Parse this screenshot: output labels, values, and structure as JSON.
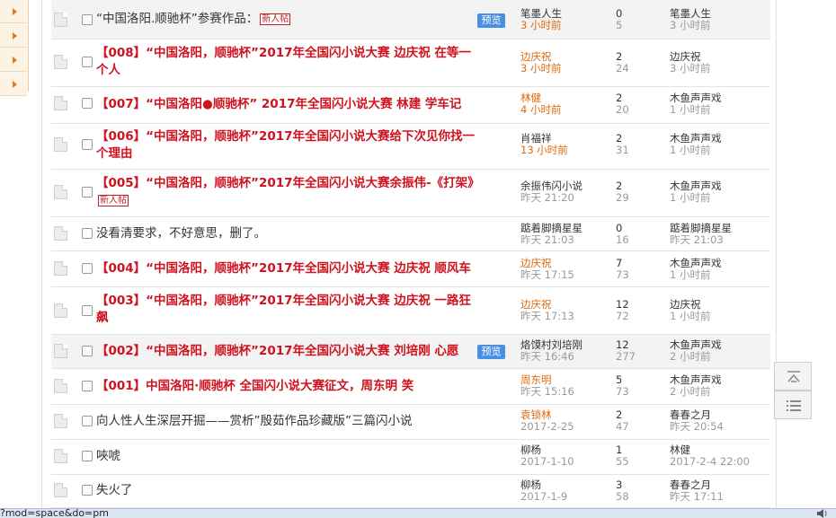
{
  "threads": [
    {
      "title": "“中国洛阳.顺驰杯”参赛作品：",
      "style": "plain",
      "newtag": "新人帖",
      "preview": "预览",
      "author": "笔墨人生",
      "author_time": "3 小时前",
      "author_orange": false,
      "time_orange": true,
      "replies": "0",
      "views": "5",
      "last": "笔墨人生",
      "last_time": "3 小时前",
      "hl": true
    },
    {
      "title": "【008】“中国洛阳，顺驰杯”2017年全国闪小说大赛 边庆祝 在等一个人",
      "style": "red",
      "author": "边庆祝",
      "author_time": "3 小时前",
      "author_orange": true,
      "time_orange": true,
      "replies": "2",
      "views": "24",
      "last": "边庆祝",
      "last_time": "3 小时前"
    },
    {
      "title": "【007】“中国洛阳●顺驰杯” 2017年全国闪小说大赛 林建 学车记",
      "style": "red",
      "author": "林健",
      "author_time": "4 小时前",
      "author_orange": true,
      "time_orange": true,
      "replies": "2",
      "views": "20",
      "last": "木鱼声声戏",
      "last_time": "1 小时前"
    },
    {
      "title": "【006】“中国洛阳，顺驰杯”2017年全国闪小说大赛给下次见你找一个理由",
      "style": "red",
      "author": "肖福祥",
      "author_time": "13 小时前",
      "author_orange": false,
      "time_orange": true,
      "replies": "2",
      "views": "31",
      "last": "木鱼声声戏",
      "last_time": "1 小时前"
    },
    {
      "title": "【005】“中国洛阳，顺驰杯”2017年全国闪小说大赛余振伟-《打架》",
      "style": "red",
      "newtag": "新人帖",
      "author": "余振伟闪小说",
      "author_time": "昨天 21:20",
      "author_orange": false,
      "time_orange": false,
      "replies": "2",
      "views": "29",
      "last": "木鱼声声戏",
      "last_time": "1 小时前"
    },
    {
      "title": "没看清要求，不好意思，删了。",
      "style": "plain",
      "author": "踮着脚摘星星",
      "author_time": "昨天 21:03",
      "author_orange": false,
      "time_orange": false,
      "replies": "0",
      "views": "16",
      "last": "踮着脚摘星星",
      "last_time": "昨天 21:03"
    },
    {
      "title": "【004】“中国洛阳，顺驰杯”2017年全国闪小说大赛 边庆祝 顺风车",
      "style": "red",
      "author": "边庆祝",
      "author_time": "昨天 17:15",
      "author_orange": true,
      "time_orange": false,
      "replies": "7",
      "views": "73",
      "last": "木鱼声声戏",
      "last_time": "1 小时前"
    },
    {
      "title": "【003】“中国洛阳，顺驰杯”2017年全国闪小说大赛 边庆祝 一路狂飙",
      "style": "red",
      "author": "边庆祝",
      "author_time": "昨天 17:13",
      "author_orange": true,
      "time_orange": false,
      "replies": "12",
      "views": "72",
      "last": "边庆祝",
      "last_time": "1 小时前"
    },
    {
      "title": "【002】“中国洛阳，顺驰杯”2017年全国闪小说大赛 刘培刚 心愿",
      "style": "red",
      "preview": "预览",
      "author": "烙馍村刘培刚",
      "author_time": "昨天 16:46",
      "author_orange": false,
      "time_orange": false,
      "replies": "12",
      "views": "277",
      "last": "木鱼声声戏",
      "last_time": "2 小时前",
      "hl": true
    },
    {
      "title": "【001】中国洛阳·顺驰杯 全国闪小说大赛征文，周东明 笑",
      "style": "red",
      "author": "周东明",
      "author_time": "昨天 15:16",
      "author_orange": true,
      "time_orange": false,
      "replies": "5",
      "views": "73",
      "last": "木鱼声声戏",
      "last_time": "2 小时前"
    },
    {
      "title": "向人性人生深层开掘——赏析”殷茹作品珍藏版”三篇闪小说",
      "style": "plain",
      "author": "袁锁林",
      "author_time": "2017-2-25",
      "author_orange": true,
      "time_orange": false,
      "replies": "2",
      "views": "47",
      "last": "春春之月",
      "last_time": "昨天 20:54"
    },
    {
      "title": "唊唬",
      "style": "plain",
      "author": "柳杨",
      "author_time": "2017-1-10",
      "author_orange": false,
      "time_orange": false,
      "replies": "1",
      "views": "55",
      "last": "林健",
      "last_time": "2017-2-4 22:00"
    },
    {
      "title": "失火了",
      "style": "plain",
      "author": "柳杨",
      "author_time": "2017-1-9",
      "author_orange": false,
      "time_orange": false,
      "replies": "3",
      "views": "58",
      "last": "春春之月",
      "last_time": "昨天 17:11"
    }
  ],
  "status_url": "?mod=space&do=pm",
  "icons": {
    "back_to_top": "back-to-top-icon",
    "list": "list-icon",
    "speaker": "speaker-icon"
  },
  "colors": {
    "red_title": "#d0121e",
    "orange": "#e06b10",
    "preview": "#4a90e2"
  }
}
